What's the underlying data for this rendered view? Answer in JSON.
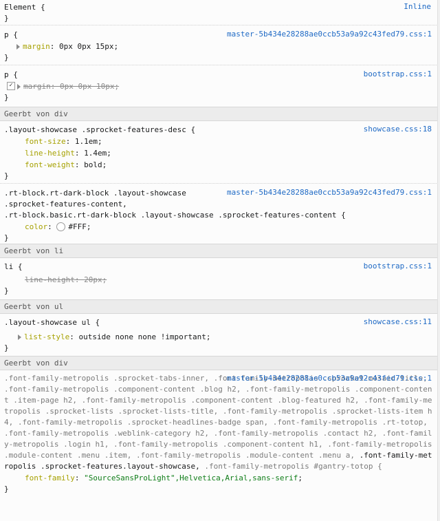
{
  "rules": {
    "element": {
      "selector": "Element {",
      "source": "Inline",
      "close": "}"
    },
    "p1": {
      "selector": "p {",
      "source": "master-5b434e28288ae0ccb53a9a92c43fed79.css:1",
      "decl": {
        "prop": "margin",
        "val": "0px 0px 15px"
      },
      "close": "}"
    },
    "p2": {
      "selector": "p {",
      "source": "bootstrap.css:1",
      "decl": {
        "prop": "margin",
        "val": "0px 0px 10px"
      },
      "close": "}"
    },
    "inherit_div1": "Geerbt von div",
    "showcase_desc": {
      "selector": ".layout-showcase .sprocket-features-desc {",
      "source": "showcase.css:18",
      "decls": [
        {
          "prop": "font-size",
          "val": "1.1em"
        },
        {
          "prop": "line-height",
          "val": "1.4em"
        },
        {
          "prop": "font-weight",
          "val": "bold"
        }
      ],
      "close": "}"
    },
    "rt_block": {
      "selector_line1": ".rt-block.rt-dark-block .layout-showcase",
      "selector_line2": ".sprocket-features-content,",
      "selector_line3": ".rt-block.basic.rt-dark-block .layout-showcase .sprocket-features-content {",
      "source": "master-5b434e28288ae0ccb53a9a92c43fed79.css:1",
      "decl": {
        "prop": "color",
        "val": "#FFF",
        "swatch": "#ffffff"
      },
      "close": "}"
    },
    "inherit_li": "Geerbt von li",
    "li": {
      "selector": "li {",
      "source": "bootstrap.css:1",
      "decl": {
        "prop": "line-height",
        "val": "20px"
      },
      "close": "}"
    },
    "inherit_ul": "Geerbt von ul",
    "showcase_ul": {
      "selector": ".layout-showcase ul {",
      "source": "showcase.css:11",
      "decl": {
        "prop": "list-style",
        "val": "outside none none !important"
      },
      "close": "}"
    },
    "inherit_div2": "Geerbt von div",
    "font_family": {
      "source": "master-5b434e28288ae0ccb53a9a92c43fed79.css:1",
      "selector_dim1": ".font-family-metropolis .sprocket-tabs-inner, .font-family-metropolis .sprocket-mosaic-title, .font-family-metropolis .component-content .blog h2, .font-family-metropolis .component-content .item-page h2, .font-family-metropolis .component-content .blog-featured h2, .font-family-metropolis .sprocket-lists .sprocket-lists-title, .font-family-metropolis .sprocket-lists-item h4, .font-family-metropolis .sprocket-headlines-badge span, .font-family-metropolis .rt-totop, .font-family-metropolis .weblink-category h2, .font-family-metropolis .contact h2, .font-family-metropolis .login h1, .font-family-metropolis .component-content h1, .font-family-metropolis .module-content .menu .item, .font-family-metropolis .module-content .menu a,",
      "selector_hi": ".font-family-metropolis .sprocket-features.layout-showcase,",
      "selector_dim2": ".font-family-metropolis #gantry-totop {",
      "decl": {
        "prop": "font-family",
        "val": "\"SourceSansProLight\",Helvetica,Arial,sans-serif"
      },
      "close": "}"
    }
  }
}
